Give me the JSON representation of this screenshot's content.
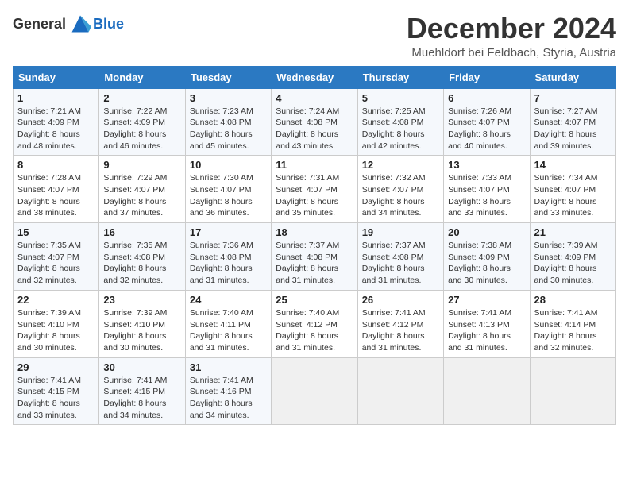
{
  "header": {
    "logo_general": "General",
    "logo_blue": "Blue",
    "month_title": "December 2024",
    "location": "Muehldorf bei Feldbach, Styria, Austria"
  },
  "weekdays": [
    "Sunday",
    "Monday",
    "Tuesday",
    "Wednesday",
    "Thursday",
    "Friday",
    "Saturday"
  ],
  "weeks": [
    [
      {
        "day": "1",
        "sunrise": "7:21 AM",
        "sunset": "4:09 PM",
        "daylight": "8 hours and 48 minutes."
      },
      {
        "day": "2",
        "sunrise": "7:22 AM",
        "sunset": "4:09 PM",
        "daylight": "8 hours and 46 minutes."
      },
      {
        "day": "3",
        "sunrise": "7:23 AM",
        "sunset": "4:08 PM",
        "daylight": "8 hours and 45 minutes."
      },
      {
        "day": "4",
        "sunrise": "7:24 AM",
        "sunset": "4:08 PM",
        "daylight": "8 hours and 43 minutes."
      },
      {
        "day": "5",
        "sunrise": "7:25 AM",
        "sunset": "4:08 PM",
        "daylight": "8 hours and 42 minutes."
      },
      {
        "day": "6",
        "sunrise": "7:26 AM",
        "sunset": "4:07 PM",
        "daylight": "8 hours and 40 minutes."
      },
      {
        "day": "7",
        "sunrise": "7:27 AM",
        "sunset": "4:07 PM",
        "daylight": "8 hours and 39 minutes."
      }
    ],
    [
      {
        "day": "8",
        "sunrise": "7:28 AM",
        "sunset": "4:07 PM",
        "daylight": "8 hours and 38 minutes."
      },
      {
        "day": "9",
        "sunrise": "7:29 AM",
        "sunset": "4:07 PM",
        "daylight": "8 hours and 37 minutes."
      },
      {
        "day": "10",
        "sunrise": "7:30 AM",
        "sunset": "4:07 PM",
        "daylight": "8 hours and 36 minutes."
      },
      {
        "day": "11",
        "sunrise": "7:31 AM",
        "sunset": "4:07 PM",
        "daylight": "8 hours and 35 minutes."
      },
      {
        "day": "12",
        "sunrise": "7:32 AM",
        "sunset": "4:07 PM",
        "daylight": "8 hours and 34 minutes."
      },
      {
        "day": "13",
        "sunrise": "7:33 AM",
        "sunset": "4:07 PM",
        "daylight": "8 hours and 33 minutes."
      },
      {
        "day": "14",
        "sunrise": "7:34 AM",
        "sunset": "4:07 PM",
        "daylight": "8 hours and 33 minutes."
      }
    ],
    [
      {
        "day": "15",
        "sunrise": "7:35 AM",
        "sunset": "4:07 PM",
        "daylight": "8 hours and 32 minutes."
      },
      {
        "day": "16",
        "sunrise": "7:35 AM",
        "sunset": "4:08 PM",
        "daylight": "8 hours and 32 minutes."
      },
      {
        "day": "17",
        "sunrise": "7:36 AM",
        "sunset": "4:08 PM",
        "daylight": "8 hours and 31 minutes."
      },
      {
        "day": "18",
        "sunrise": "7:37 AM",
        "sunset": "4:08 PM",
        "daylight": "8 hours and 31 minutes."
      },
      {
        "day": "19",
        "sunrise": "7:37 AM",
        "sunset": "4:08 PM",
        "daylight": "8 hours and 31 minutes."
      },
      {
        "day": "20",
        "sunrise": "7:38 AM",
        "sunset": "4:09 PM",
        "daylight": "8 hours and 30 minutes."
      },
      {
        "day": "21",
        "sunrise": "7:39 AM",
        "sunset": "4:09 PM",
        "daylight": "8 hours and 30 minutes."
      }
    ],
    [
      {
        "day": "22",
        "sunrise": "7:39 AM",
        "sunset": "4:10 PM",
        "daylight": "8 hours and 30 minutes."
      },
      {
        "day": "23",
        "sunrise": "7:39 AM",
        "sunset": "4:10 PM",
        "daylight": "8 hours and 30 minutes."
      },
      {
        "day": "24",
        "sunrise": "7:40 AM",
        "sunset": "4:11 PM",
        "daylight": "8 hours and 31 minutes."
      },
      {
        "day": "25",
        "sunrise": "7:40 AM",
        "sunset": "4:12 PM",
        "daylight": "8 hours and 31 minutes."
      },
      {
        "day": "26",
        "sunrise": "7:41 AM",
        "sunset": "4:12 PM",
        "daylight": "8 hours and 31 minutes."
      },
      {
        "day": "27",
        "sunrise": "7:41 AM",
        "sunset": "4:13 PM",
        "daylight": "8 hours and 31 minutes."
      },
      {
        "day": "28",
        "sunrise": "7:41 AM",
        "sunset": "4:14 PM",
        "daylight": "8 hours and 32 minutes."
      }
    ],
    [
      {
        "day": "29",
        "sunrise": "7:41 AM",
        "sunset": "4:15 PM",
        "daylight": "8 hours and 33 minutes."
      },
      {
        "day": "30",
        "sunrise": "7:41 AM",
        "sunset": "4:15 PM",
        "daylight": "8 hours and 34 minutes."
      },
      {
        "day": "31",
        "sunrise": "7:41 AM",
        "sunset": "4:16 PM",
        "daylight": "8 hours and 34 minutes."
      },
      null,
      null,
      null,
      null
    ]
  ],
  "labels": {
    "sunrise": "Sunrise:",
    "sunset": "Sunset:",
    "daylight": "Daylight:"
  }
}
